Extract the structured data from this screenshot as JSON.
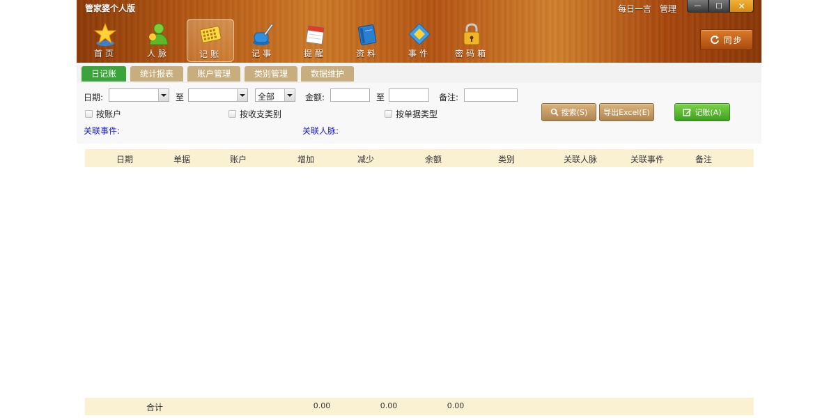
{
  "app": {
    "title": "管家婆个人版"
  },
  "top_links": {
    "daily_quote": "每日一言",
    "manage": "管理"
  },
  "window_controls": {
    "minimize": "—",
    "maximize": "□",
    "close": "✕"
  },
  "nav": [
    {
      "label": "首页",
      "icon": "star-icon"
    },
    {
      "label": "人脉",
      "icon": "person-icon"
    },
    {
      "label": "记账",
      "icon": "abacus-icon",
      "active": true
    },
    {
      "label": "记事",
      "icon": "ink-pen-icon"
    },
    {
      "label": "提醒",
      "icon": "calendar-icon"
    },
    {
      "label": "资料",
      "icon": "book-icon"
    },
    {
      "label": "事件",
      "icon": "diamond-icon"
    },
    {
      "label": "密码箱",
      "icon": "lock-icon"
    }
  ],
  "sync_button": {
    "label": "同步"
  },
  "tabs": [
    {
      "label": "日记账",
      "active": true
    },
    {
      "label": "统计报表"
    },
    {
      "label": "账户管理"
    },
    {
      "label": "类别管理"
    },
    {
      "label": "数据维护"
    }
  ],
  "filters": {
    "date_label": "日期:",
    "to_label_1": "至",
    "date_from": "",
    "date_to": "",
    "type_value": "全部",
    "amount_label": "金额:",
    "to_label_2": "至",
    "amount_from": "",
    "amount_to": "",
    "note_label": "备注:",
    "note_value": "",
    "by_account": "按账户",
    "by_category": "按收支类别",
    "by_doc_type": "按单据类型",
    "related_event": "关联事件:",
    "related_contact": "关联人脉:"
  },
  "buttons": {
    "search": "搜索(S)",
    "export": "导出Excel(E)",
    "record": "记账(A)"
  },
  "table": {
    "columns": [
      "日期",
      "单据",
      "账户",
      "增加",
      "减少",
      "余额",
      "类别",
      "关联人脉",
      "关联事件",
      "备注"
    ],
    "rows": [],
    "footer": {
      "label": "合计",
      "increase": "0.00",
      "decrease": "0.00",
      "balance": "0.00"
    }
  },
  "colors": {
    "tab_active": "#3aa33a",
    "tab_inactive": "#c8ad7f",
    "link": "#1a1ad4",
    "table_header": "#faf0d2"
  }
}
